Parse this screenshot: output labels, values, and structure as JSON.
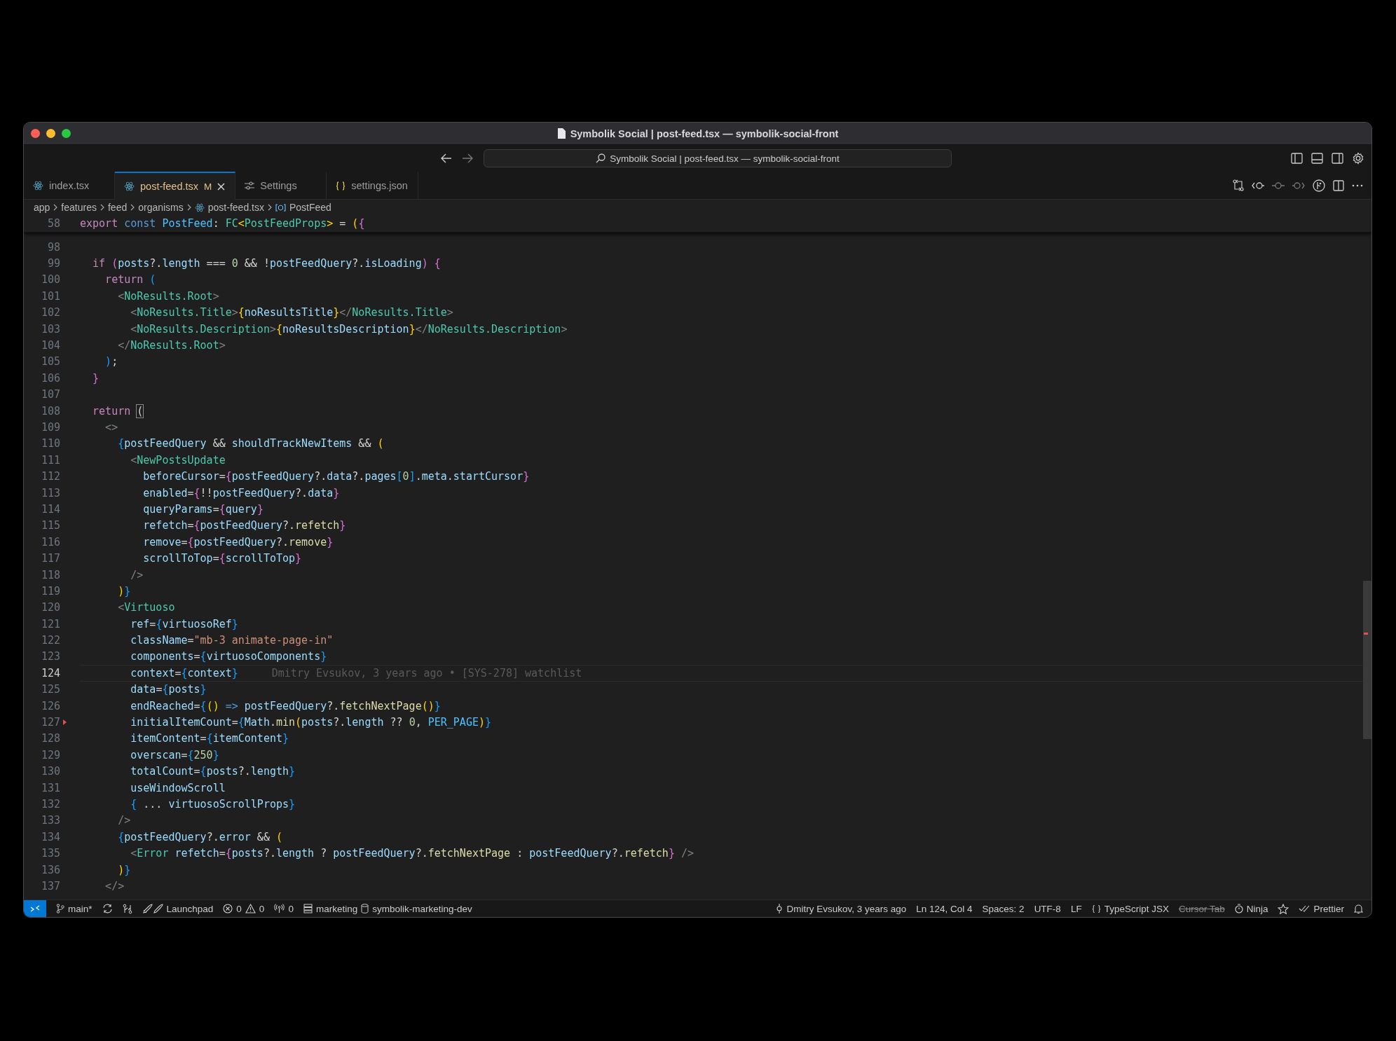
{
  "window": {
    "title": "Symbolik Social | post-feed.tsx — symbolik-social-front"
  },
  "command_center": {
    "text": "Symbolik Social | post-feed.tsx — symbolik-social-front"
  },
  "tabs": [
    {
      "label": "index.tsx",
      "kind": "react",
      "selected": false
    },
    {
      "label": "post-feed.tsx",
      "kind": "react",
      "selected": true,
      "badge": "M"
    },
    {
      "label": "Settings",
      "kind": "settings",
      "selected": false
    },
    {
      "label": "settings.json",
      "kind": "json",
      "selected": false
    }
  ],
  "breadcrumbs": [
    {
      "label": "app",
      "kind": "folder"
    },
    {
      "label": "features",
      "kind": "folder"
    },
    {
      "label": "feed",
      "kind": "folder"
    },
    {
      "label": "organisms",
      "kind": "folder"
    },
    {
      "label": "post-feed.tsx",
      "kind": "file"
    },
    {
      "label": "PostFeed",
      "kind": "symbol"
    }
  ],
  "sticky_line": {
    "number": "58",
    "tokens": [
      {
        "text": "export ",
        "kind": "kw"
      },
      {
        "text": "const ",
        "kind": "st"
      },
      {
        "text": "PostFeed",
        "kind": "c"
      },
      {
        "text": ": ",
        "kind": "p"
      },
      {
        "text": "FC",
        "kind": "ty"
      },
      {
        "text": "<",
        "kind": "b1"
      },
      {
        "text": "PostFeedProps",
        "kind": "ty"
      },
      {
        "text": ">",
        "kind": "b1"
      },
      {
        "text": " = ",
        "kind": "p"
      },
      {
        "text": "(",
        "kind": "b1"
      },
      {
        "text": "{",
        "kind": "b2"
      }
    ]
  },
  "lines": [
    {
      "number": "98",
      "selected": false,
      "deleted_marker": false
    },
    {
      "number": "99",
      "selected": false,
      "deleted_marker": false,
      "tokens": [
        {
          "text": "  if ",
          "kind": "kw"
        },
        {
          "text": "(",
          "kind": "b2"
        },
        {
          "text": "posts",
          "kind": "v"
        },
        {
          "text": "?.",
          "kind": "p"
        },
        {
          "text": "length",
          "kind": "v"
        },
        {
          "text": " === ",
          "kind": "p"
        },
        {
          "text": "0",
          "kind": "n"
        },
        {
          "text": " && !",
          "kind": "p"
        },
        {
          "text": "postFeedQuery",
          "kind": "v"
        },
        {
          "text": "?.",
          "kind": "p"
        },
        {
          "text": "isLoading",
          "kind": "v"
        },
        {
          "text": ") {",
          "kind": "b2"
        }
      ]
    },
    {
      "number": "100",
      "selected": false,
      "deleted_marker": false,
      "tokens": [
        {
          "text": "    return ",
          "kind": "kw"
        },
        {
          "text": "(",
          "kind": "b3"
        }
      ]
    },
    {
      "number": "101",
      "selected": false,
      "deleted_marker": false,
      "tokens": [
        {
          "text": "      <",
          "kind": "tp"
        },
        {
          "text": "NoResults.Root",
          "kind": "ty"
        },
        {
          "text": ">",
          "kind": "tp"
        }
      ]
    },
    {
      "number": "102",
      "selected": false,
      "deleted_marker": false,
      "tokens": [
        {
          "text": "        <",
          "kind": "tp"
        },
        {
          "text": "NoResults.Title",
          "kind": "ty"
        },
        {
          "text": ">",
          "kind": "tp"
        },
        {
          "text": "{",
          "kind": "b1"
        },
        {
          "text": "noResultsTitle",
          "kind": "v"
        },
        {
          "text": "}",
          "kind": "b1"
        },
        {
          "text": "</",
          "kind": "tp"
        },
        {
          "text": "NoResults.Title",
          "kind": "ty"
        },
        {
          "text": ">",
          "kind": "tp"
        }
      ]
    },
    {
      "number": "103",
      "selected": false,
      "deleted_marker": false,
      "tokens": [
        {
          "text": "        <",
          "kind": "tp"
        },
        {
          "text": "NoResults.Description",
          "kind": "ty"
        },
        {
          "text": ">",
          "kind": "tp"
        },
        {
          "text": "{",
          "kind": "b1"
        },
        {
          "text": "noResultsDescription",
          "kind": "v"
        },
        {
          "text": "}",
          "kind": "b1"
        },
        {
          "text": "</",
          "kind": "tp"
        },
        {
          "text": "NoResults.Description",
          "kind": "ty"
        },
        {
          "text": ">",
          "kind": "tp"
        }
      ]
    },
    {
      "number": "104",
      "selected": false,
      "deleted_marker": false,
      "tokens": [
        {
          "text": "      </",
          "kind": "tp"
        },
        {
          "text": "NoResults.Root",
          "kind": "ty"
        },
        {
          "text": ">",
          "kind": "tp"
        }
      ]
    },
    {
      "number": "105",
      "selected": false,
      "deleted_marker": false,
      "tokens": [
        {
          "text": "    )",
          "kind": "b3"
        },
        {
          "text": ";",
          "kind": "p"
        }
      ]
    },
    {
      "number": "106",
      "selected": false,
      "deleted_marker": false,
      "tokens": [
        {
          "text": "  }",
          "kind": "b2"
        }
      ]
    },
    {
      "number": "107",
      "selected": false,
      "deleted_marker": false
    },
    {
      "number": "108",
      "selected": false,
      "deleted_marker": false,
      "tokens": [
        {
          "text": "  return ",
          "kind": "kw"
        },
        {
          "text": "(",
          "kind": "m"
        }
      ]
    },
    {
      "number": "109",
      "selected": false,
      "deleted_marker": false,
      "tokens": [
        {
          "text": "    <>",
          "kind": "tp"
        }
      ]
    },
    {
      "number": "110",
      "selected": false,
      "deleted_marker": false,
      "tokens": [
        {
          "text": "      {",
          "kind": "b3"
        },
        {
          "text": "postFeedQuery",
          "kind": "v"
        },
        {
          "text": " && ",
          "kind": "p"
        },
        {
          "text": "shouldTrackNewItems",
          "kind": "v"
        },
        {
          "text": " && ",
          "kind": "p"
        },
        {
          "text": "(",
          "kind": "b1"
        }
      ]
    },
    {
      "number": "111",
      "selected": false,
      "deleted_marker": false,
      "tokens": [
        {
          "text": "        <",
          "kind": "tp"
        },
        {
          "text": "NewPostsUpdate",
          "kind": "ty"
        }
      ]
    },
    {
      "number": "112",
      "selected": false,
      "deleted_marker": false,
      "tokens": [
        {
          "text": "          beforeCursor",
          "kind": "v"
        },
        {
          "text": "=",
          "kind": "p"
        },
        {
          "text": "{",
          "kind": "b2"
        },
        {
          "text": "postFeedQuery",
          "kind": "v"
        },
        {
          "text": "?.",
          "kind": "p"
        },
        {
          "text": "data",
          "kind": "v"
        },
        {
          "text": "?.",
          "kind": "p"
        },
        {
          "text": "pages",
          "kind": "v"
        },
        {
          "text": "[",
          "kind": "b3"
        },
        {
          "text": "0",
          "kind": "n"
        },
        {
          "text": "]",
          "kind": "b3"
        },
        {
          "text": ".",
          "kind": "p"
        },
        {
          "text": "meta",
          "kind": "v"
        },
        {
          "text": ".",
          "kind": "p"
        },
        {
          "text": "startCursor",
          "kind": "v"
        },
        {
          "text": "}",
          "kind": "b2"
        }
      ]
    },
    {
      "number": "113",
      "selected": false,
      "deleted_marker": false,
      "tokens": [
        {
          "text": "          enabled",
          "kind": "v"
        },
        {
          "text": "=",
          "kind": "p"
        },
        {
          "text": "{",
          "kind": "b2"
        },
        {
          "text": "!!",
          "kind": "p"
        },
        {
          "text": "postFeedQuery",
          "kind": "v"
        },
        {
          "text": "?.",
          "kind": "p"
        },
        {
          "text": "data",
          "kind": "v"
        },
        {
          "text": "}",
          "kind": "b2"
        }
      ]
    },
    {
      "number": "114",
      "selected": false,
      "deleted_marker": false,
      "tokens": [
        {
          "text": "          queryParams",
          "kind": "v"
        },
        {
          "text": "=",
          "kind": "p"
        },
        {
          "text": "{",
          "kind": "b2"
        },
        {
          "text": "query",
          "kind": "v"
        },
        {
          "text": "}",
          "kind": "b2"
        }
      ]
    },
    {
      "number": "115",
      "selected": false,
      "deleted_marker": false,
      "tokens": [
        {
          "text": "          refetch",
          "kind": "v"
        },
        {
          "text": "=",
          "kind": "p"
        },
        {
          "text": "{",
          "kind": "b2"
        },
        {
          "text": "postFeedQuery",
          "kind": "v"
        },
        {
          "text": "?.",
          "kind": "p"
        },
        {
          "text": "refetch",
          "kind": "f"
        },
        {
          "text": "}",
          "kind": "b2"
        }
      ]
    },
    {
      "number": "116",
      "selected": false,
      "deleted_marker": false,
      "tokens": [
        {
          "text": "          remove",
          "kind": "v"
        },
        {
          "text": "=",
          "kind": "p"
        },
        {
          "text": "{",
          "kind": "b2"
        },
        {
          "text": "postFeedQuery",
          "kind": "v"
        },
        {
          "text": "?.",
          "kind": "p"
        },
        {
          "text": "remove",
          "kind": "f"
        },
        {
          "text": "}",
          "kind": "b2"
        }
      ]
    },
    {
      "number": "117",
      "selected": false,
      "deleted_marker": false,
      "tokens": [
        {
          "text": "          scrollToTop",
          "kind": "v"
        },
        {
          "text": "=",
          "kind": "p"
        },
        {
          "text": "{",
          "kind": "b2"
        },
        {
          "text": "scrollToTop",
          "kind": "v"
        },
        {
          "text": "}",
          "kind": "b2"
        }
      ]
    },
    {
      "number": "118",
      "selected": false,
      "deleted_marker": false,
      "tokens": [
        {
          "text": "        />",
          "kind": "tp"
        }
      ]
    },
    {
      "number": "119",
      "selected": false,
      "deleted_marker": false,
      "tokens": [
        {
          "text": "      )",
          "kind": "b1"
        },
        {
          "text": "}",
          "kind": "b3"
        }
      ]
    },
    {
      "number": "120",
      "selected": false,
      "deleted_marker": false,
      "tokens": [
        {
          "text": "      <",
          "kind": "tp"
        },
        {
          "text": "Virtuoso",
          "kind": "ty"
        }
      ]
    },
    {
      "number": "121",
      "selected": false,
      "deleted_marker": false,
      "tokens": [
        {
          "text": "        ref",
          "kind": "v"
        },
        {
          "text": "=",
          "kind": "p"
        },
        {
          "text": "{",
          "kind": "b3"
        },
        {
          "text": "virtuosoRef",
          "kind": "v"
        },
        {
          "text": "}",
          "kind": "b3"
        }
      ]
    },
    {
      "number": "122",
      "selected": false,
      "deleted_marker": false,
      "tokens": [
        {
          "text": "        className",
          "kind": "v"
        },
        {
          "text": "=",
          "kind": "p"
        },
        {
          "text": "\"mb-3 animate-page-in\"",
          "kind": "s"
        }
      ]
    },
    {
      "number": "123",
      "selected": false,
      "deleted_marker": false,
      "tokens": [
        {
          "text": "        components",
          "kind": "v"
        },
        {
          "text": "=",
          "kind": "p"
        },
        {
          "text": "{",
          "kind": "b3"
        },
        {
          "text": "virtuosoComponents",
          "kind": "v"
        },
        {
          "text": "}",
          "kind": "b3"
        }
      ]
    },
    {
      "number": "124",
      "selected": true,
      "deleted_marker": false,
      "tokens": [
        {
          "text": "        context",
          "kind": "v"
        },
        {
          "text": "=",
          "kind": "p"
        },
        {
          "text": "{",
          "kind": "b3"
        },
        {
          "text": "context",
          "kind": "v"
        },
        {
          "text": "}",
          "kind": "b3"
        }
      ],
      "blame": "Dmitry Evsukov, 3 years ago • [SYS-278] watchlist"
    },
    {
      "number": "125",
      "selected": false,
      "deleted_marker": false,
      "tokens": [
        {
          "text": "        data",
          "kind": "v"
        },
        {
          "text": "=",
          "kind": "p"
        },
        {
          "text": "{",
          "kind": "b3"
        },
        {
          "text": "posts",
          "kind": "v"
        },
        {
          "text": "}",
          "kind": "b3"
        }
      ]
    },
    {
      "number": "126",
      "selected": false,
      "deleted_marker": false,
      "tokens": [
        {
          "text": "        endReached",
          "kind": "v"
        },
        {
          "text": "=",
          "kind": "p"
        },
        {
          "text": "{",
          "kind": "b3"
        },
        {
          "text": "()",
          "kind": "b1"
        },
        {
          "text": " => ",
          "kind": "st"
        },
        {
          "text": "postFeedQuery",
          "kind": "v"
        },
        {
          "text": "?.",
          "kind": "p"
        },
        {
          "text": "fetchNextPage",
          "kind": "f"
        },
        {
          "text": "()",
          "kind": "b1"
        },
        {
          "text": "}",
          "kind": "b3"
        }
      ]
    },
    {
      "number": "127",
      "selected": false,
      "deleted_marker": true,
      "tokens": [
        {
          "text": "        initialItemCount",
          "kind": "v"
        },
        {
          "text": "=",
          "kind": "p"
        },
        {
          "text": "{",
          "kind": "b3"
        },
        {
          "text": "Math",
          "kind": "v"
        },
        {
          "text": ".",
          "kind": "p"
        },
        {
          "text": "min",
          "kind": "f"
        },
        {
          "text": "(",
          "kind": "b1"
        },
        {
          "text": "posts",
          "kind": "v"
        },
        {
          "text": "?.",
          "kind": "p"
        },
        {
          "text": "length",
          "kind": "v"
        },
        {
          "text": " ?? ",
          "kind": "p"
        },
        {
          "text": "0",
          "kind": "n"
        },
        {
          "text": ", ",
          "kind": "p"
        },
        {
          "text": "PER_PAGE",
          "kind": "c"
        },
        {
          "text": ")",
          "kind": "b1"
        },
        {
          "text": "}",
          "kind": "b3"
        }
      ]
    },
    {
      "number": "128",
      "selected": false,
      "deleted_marker": false,
      "tokens": [
        {
          "text": "        itemContent",
          "kind": "v"
        },
        {
          "text": "=",
          "kind": "p"
        },
        {
          "text": "{",
          "kind": "b3"
        },
        {
          "text": "itemContent",
          "kind": "v"
        },
        {
          "text": "}",
          "kind": "b3"
        }
      ]
    },
    {
      "number": "129",
      "selected": false,
      "deleted_marker": false,
      "tokens": [
        {
          "text": "        overscan",
          "kind": "v"
        },
        {
          "text": "=",
          "kind": "p"
        },
        {
          "text": "{",
          "kind": "b3"
        },
        {
          "text": "250",
          "kind": "n"
        },
        {
          "text": "}",
          "kind": "b3"
        }
      ]
    },
    {
      "number": "130",
      "selected": false,
      "deleted_marker": false,
      "tokens": [
        {
          "text": "        totalCount",
          "kind": "v"
        },
        {
          "text": "=",
          "kind": "p"
        },
        {
          "text": "{",
          "kind": "b3"
        },
        {
          "text": "posts",
          "kind": "v"
        },
        {
          "text": "?.",
          "kind": "p"
        },
        {
          "text": "length",
          "kind": "v"
        },
        {
          "text": "}",
          "kind": "b3"
        }
      ]
    },
    {
      "number": "131",
      "selected": false,
      "deleted_marker": false,
      "tokens": [
        {
          "text": "        useWindowScroll",
          "kind": "v"
        }
      ]
    },
    {
      "number": "132",
      "selected": false,
      "deleted_marker": false,
      "tokens": [
        {
          "text": "        {",
          "kind": "b3"
        },
        {
          "text": " ... ",
          "kind": "p"
        },
        {
          "text": "virtuosoScrollProps",
          "kind": "v"
        },
        {
          "text": "}",
          "kind": "b3"
        }
      ]
    },
    {
      "number": "133",
      "selected": false,
      "deleted_marker": false,
      "tokens": [
        {
          "text": "      />",
          "kind": "tp"
        }
      ]
    },
    {
      "number": "134",
      "selected": false,
      "deleted_marker": false,
      "tokens": [
        {
          "text": "      {",
          "kind": "b3"
        },
        {
          "text": "postFeedQuery",
          "kind": "v"
        },
        {
          "text": "?.",
          "kind": "p"
        },
        {
          "text": "error",
          "kind": "v"
        },
        {
          "text": " && ",
          "kind": "p"
        },
        {
          "text": "(",
          "kind": "b1"
        }
      ]
    },
    {
      "number": "135",
      "selected": false,
      "deleted_marker": false,
      "tokens": [
        {
          "text": "        <",
          "kind": "tp"
        },
        {
          "text": "Error ",
          "kind": "ty"
        },
        {
          "text": "refetch",
          "kind": "v"
        },
        {
          "text": "=",
          "kind": "p"
        },
        {
          "text": "{",
          "kind": "b2"
        },
        {
          "text": "posts",
          "kind": "v"
        },
        {
          "text": "?.",
          "kind": "p"
        },
        {
          "text": "length",
          "kind": "v"
        },
        {
          "text": " ? ",
          "kind": "p"
        },
        {
          "text": "postFeedQuery",
          "kind": "v"
        },
        {
          "text": "?.",
          "kind": "p"
        },
        {
          "text": "fetchNextPage",
          "kind": "f"
        },
        {
          "text": " : ",
          "kind": "p"
        },
        {
          "text": "postFeedQuery",
          "kind": "v"
        },
        {
          "text": "?.",
          "kind": "p"
        },
        {
          "text": "refetch",
          "kind": "f"
        },
        {
          "text": "}",
          "kind": "b2"
        },
        {
          "text": " />",
          "kind": "tp"
        }
      ]
    },
    {
      "number": "136",
      "selected": false,
      "deleted_marker": false,
      "tokens": [
        {
          "text": "      )",
          "kind": "b1"
        },
        {
          "text": "}",
          "kind": "b3"
        }
      ]
    },
    {
      "number": "137",
      "selected": false,
      "deleted_marker": false,
      "tokens": [
        {
          "text": "    </>",
          "kind": "tp"
        }
      ]
    }
  ],
  "status_bar": {
    "branch": "main*",
    "launchpad": "Launchpad",
    "errors": "0",
    "warnings": "0",
    "ports": "0",
    "database": "marketing",
    "connection": "symbolik-marketing-dev",
    "blame": "Dmitry Evsukov, 3 years ago",
    "position": "Ln 124, Col 4",
    "indentation": "Spaces: 2",
    "encoding": "UTF-8",
    "eol": "LF",
    "language": "TypeScript JSX",
    "cursor_tab": {
      "label": "Cursor Tab",
      "disabled": true
    },
    "ninja": "Ninja",
    "formatter": "Prettier"
  }
}
